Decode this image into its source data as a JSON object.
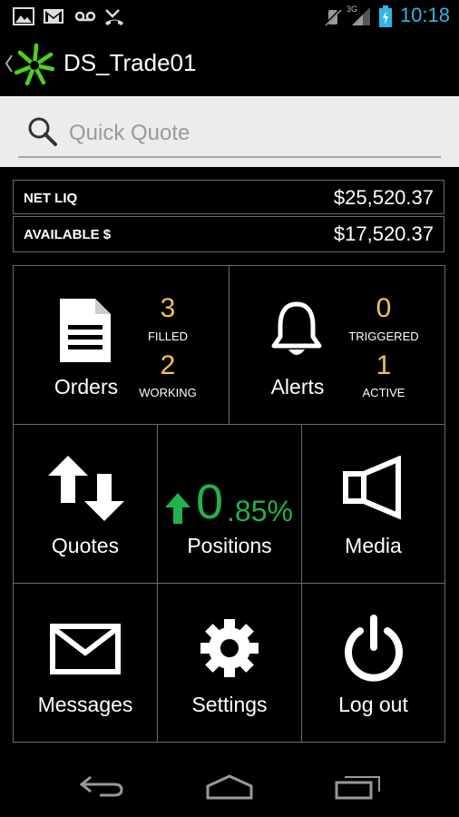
{
  "status": {
    "clock": "10:18",
    "network": "3G"
  },
  "app": {
    "title": "DS_Trade01"
  },
  "search": {
    "placeholder": "Quick Quote"
  },
  "account": [
    {
      "label": "NET LIQ",
      "value": "$25,520.37"
    },
    {
      "label": "AVAILABLE $",
      "value": "$17,520.37"
    }
  ],
  "tiles": {
    "orders": {
      "label": "Orders",
      "filled_count": "3",
      "filled_label": "FILLED",
      "working_count": "2",
      "working_label": "WORKING"
    },
    "alerts": {
      "label": "Alerts",
      "triggered_count": "0",
      "triggered_label": "TRIGGERED",
      "active_count": "1",
      "active_label": "ACTIVE"
    },
    "quotes": {
      "label": "Quotes"
    },
    "positions": {
      "label": "Positions",
      "change_int": "0",
      "change_dec": ".85%"
    },
    "media": {
      "label": "Media"
    },
    "messages": {
      "label": "Messages"
    },
    "settings": {
      "label": "Settings"
    },
    "logout": {
      "label": "Log out"
    }
  },
  "colors": {
    "accent_green": "#22b24c",
    "count_yellow": "#f0c05a",
    "clock_blue": "#33b5e5"
  }
}
